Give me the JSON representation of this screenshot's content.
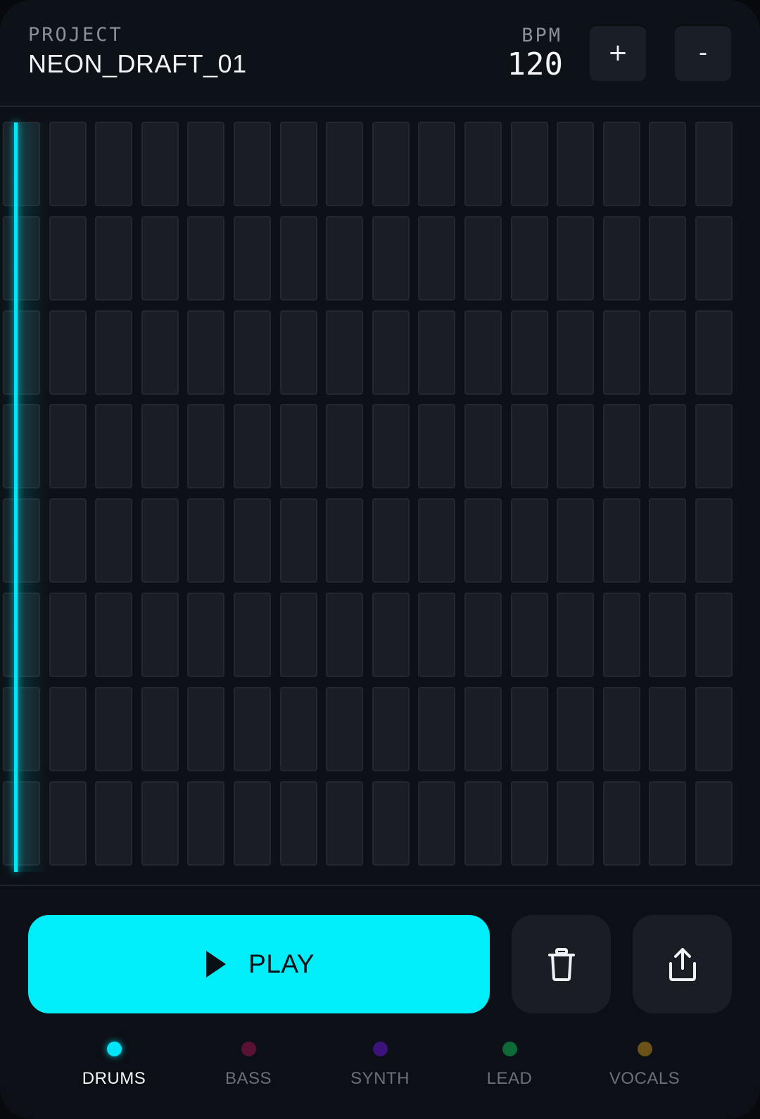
{
  "header": {
    "project_label": "PROJECT",
    "project_name": "NEON_DRAFT_01",
    "bpm_label": "BPM",
    "bpm_value": "120",
    "bpm_increase_label": "+",
    "bpm_decrease_label": "-"
  },
  "sequencer": {
    "rows": 8,
    "steps": 16,
    "playhead_step": 1,
    "active_cells": []
  },
  "controls": {
    "play_label": "PLAY",
    "play_icon": "play-icon",
    "trash_icon": "trash-icon",
    "share_icon": "share-icon"
  },
  "tracks": [
    {
      "label": "DRUMS",
      "color": "#00e5f7",
      "selected": true
    },
    {
      "label": "BASS",
      "color": "#5a1234",
      "selected": false
    },
    {
      "label": "SYNTH",
      "color": "#3b137a",
      "selected": false
    },
    {
      "label": "LEAD",
      "color": "#0e6a36",
      "selected": false
    },
    {
      "label": "VOCALS",
      "color": "#6b5218",
      "selected": false
    }
  ],
  "colors": {
    "accent": "#00eefa",
    "background": "#0c0f15",
    "cell": "#1a1d24"
  }
}
